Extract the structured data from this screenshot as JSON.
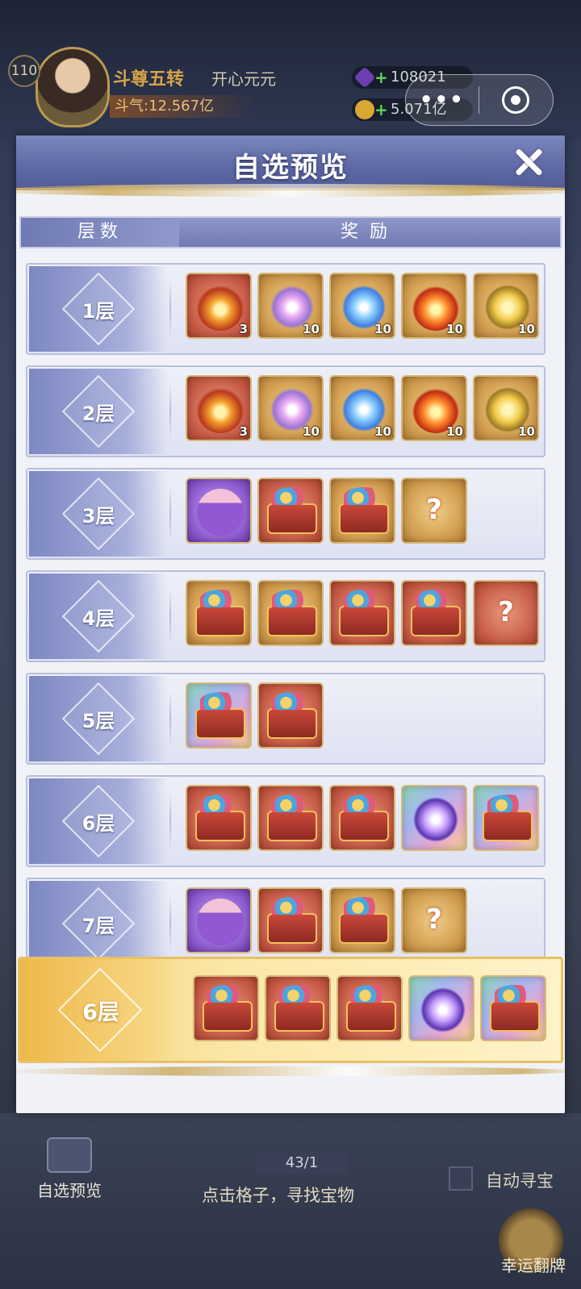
{
  "hud": {
    "level": "110",
    "title": "斗尊五转",
    "nickname": "开心元元",
    "power": "斗气:12.567亿",
    "currency1": "108021",
    "currency2": "5.071亿",
    "capsule_more": "•••"
  },
  "modal": {
    "title": "自选预览",
    "col_tier": "层数",
    "col_reward": "奖励"
  },
  "rows": [
    {
      "label": "1层",
      "items": [
        {
          "bg": "red",
          "art": "flame",
          "qty": "3"
        },
        {
          "bg": "gold",
          "art": "lotus",
          "qty": "10"
        },
        {
          "bg": "gold",
          "art": "crystal",
          "qty": "10"
        },
        {
          "bg": "gold",
          "art": "fire",
          "qty": "10"
        },
        {
          "bg": "gold",
          "art": "stone",
          "qty": "10"
        }
      ]
    },
    {
      "label": "2层",
      "items": [
        {
          "bg": "red",
          "art": "flame",
          "qty": "3"
        },
        {
          "bg": "gold",
          "art": "lotus",
          "qty": "10"
        },
        {
          "bg": "gold",
          "art": "crystal",
          "qty": "10"
        },
        {
          "bg": "gold",
          "art": "fire",
          "qty": "10"
        },
        {
          "bg": "gold",
          "art": "stone",
          "qty": "10"
        }
      ]
    },
    {
      "label": "3层",
      "items": [
        {
          "bg": "purple",
          "art": "gift",
          "qty": ""
        },
        {
          "bg": "red",
          "art": "chest",
          "qty": ""
        },
        {
          "bg": "gold",
          "art": "chest",
          "qty": ""
        },
        {
          "bg": "gold",
          "art": "question",
          "qty": ""
        }
      ]
    },
    {
      "label": "4层",
      "items": [
        {
          "bg": "gold",
          "art": "chest",
          "qty": ""
        },
        {
          "bg": "gold",
          "art": "chest",
          "qty": ""
        },
        {
          "bg": "red",
          "art": "chest",
          "qty": ""
        },
        {
          "bg": "red",
          "art": "chest",
          "qty": ""
        },
        {
          "bg": "red",
          "art": "question",
          "qty": ""
        }
      ]
    },
    {
      "label": "5层",
      "items": [
        {
          "bg": "rainbow",
          "art": "chest",
          "qty": ""
        },
        {
          "bg": "red",
          "art": "chest",
          "qty": ""
        }
      ]
    },
    {
      "label": "6层",
      "items": [
        {
          "bg": "red",
          "art": "chest",
          "qty": ""
        },
        {
          "bg": "red",
          "art": "chest",
          "qty": ""
        },
        {
          "bg": "red",
          "art": "chest",
          "qty": ""
        },
        {
          "bg": "rainbow",
          "art": "orb",
          "qty": ""
        },
        {
          "bg": "rainbow",
          "art": "chest",
          "qty": ""
        }
      ]
    },
    {
      "label": "7层",
      "items": [
        {
          "bg": "purple",
          "art": "gift",
          "qty": ""
        },
        {
          "bg": "red",
          "art": "chest",
          "qty": ""
        },
        {
          "bg": "gold",
          "art": "chest",
          "qty": ""
        },
        {
          "bg": "gold",
          "art": "question",
          "qty": ""
        }
      ]
    }
  ],
  "current": {
    "label": "6层",
    "items": [
      {
        "bg": "red",
        "art": "chest"
      },
      {
        "bg": "red",
        "art": "chest"
      },
      {
        "bg": "red",
        "art": "chest"
      },
      {
        "bg": "rainbow",
        "art": "orb"
      },
      {
        "bg": "rainbow",
        "art": "chest"
      }
    ]
  },
  "bottom": {
    "auto_pick": "自选预览",
    "progress": "43/1",
    "hint": "点击格子，寻找宝物",
    "auto_search": "自动寻宝",
    "lucky_flip": "幸运翻牌"
  },
  "colors": {
    "header_blue": "#5e69a5",
    "gold_accent": "#c8a964",
    "current_row_gold": "#f6d27a"
  }
}
